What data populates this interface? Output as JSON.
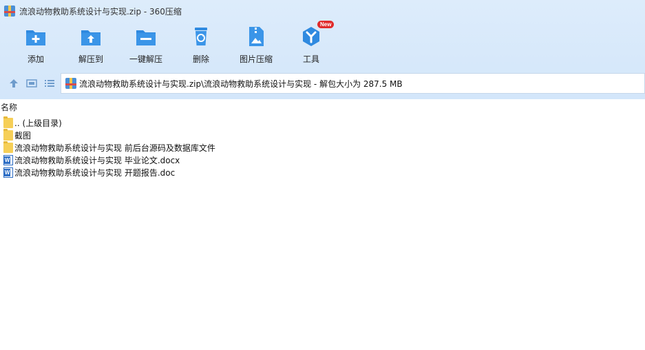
{
  "window": {
    "title": "流浪动物救助系统设计与实现.zip - 360压缩"
  },
  "toolbar": [
    {
      "label": "添加",
      "icon": "add-folder-icon"
    },
    {
      "label": "解压到",
      "icon": "extract-to-icon"
    },
    {
      "label": "一键解压",
      "icon": "one-click-extract-icon"
    },
    {
      "label": "删除",
      "icon": "trash-icon"
    },
    {
      "label": "图片压缩",
      "icon": "image-compress-icon"
    },
    {
      "label": "工具",
      "icon": "tools-icon",
      "badge": "New"
    }
  ],
  "nav": {
    "address": "流浪动物救助系统设计与实现.zip\\流浪动物救助系统设计与实现 - 解包大小为 287.5 MB"
  },
  "list": {
    "column_name": "名称",
    "items": [
      {
        "name": ".. (上级目录)",
        "type": "parent-folder"
      },
      {
        "name": "截图",
        "type": "folder"
      },
      {
        "name": "流浪动物救助系统设计与实现 前后台源码及数据库文件",
        "type": "folder"
      },
      {
        "name": "流浪动物救助系统设计与实现 毕业论文.docx",
        "type": "word"
      },
      {
        "name": "流浪动物救助系统设计与实现 开题报告.doc",
        "type": "word"
      }
    ]
  },
  "colors": {
    "accent": "#2f8ae0",
    "header_bg": "#d8e9fb",
    "badge": "#e02b2b"
  }
}
